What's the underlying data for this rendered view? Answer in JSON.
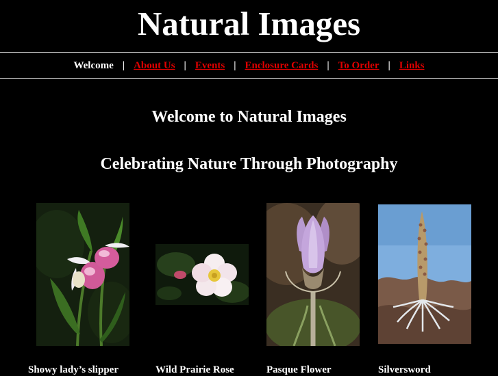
{
  "site": {
    "title": "Natural Images"
  },
  "nav": {
    "items": [
      {
        "label": "Welcome",
        "current": true
      },
      {
        "label": "About Us",
        "current": false
      },
      {
        "label": "Events",
        "current": false
      },
      {
        "label": "Enclosure Cards",
        "current": false
      },
      {
        "label": "To Order",
        "current": false
      },
      {
        "label": "Links",
        "current": false
      }
    ],
    "separator": "|",
    "link_color": "#e00000"
  },
  "main": {
    "heading": "Welcome to Natural Images",
    "subheading": "Celebrating Nature Through Photography"
  },
  "gallery": [
    {
      "caption": "Showy lady’s slipper",
      "image": "lady-slipper-orchid-photo"
    },
    {
      "caption": "Wild Prairie Rose",
      "image": "wild-prairie-rose-photo"
    },
    {
      "caption": "Pasque Flower",
      "image": "pasque-flower-photo"
    },
    {
      "caption": "Silversword",
      "image": "silversword-photo"
    }
  ]
}
